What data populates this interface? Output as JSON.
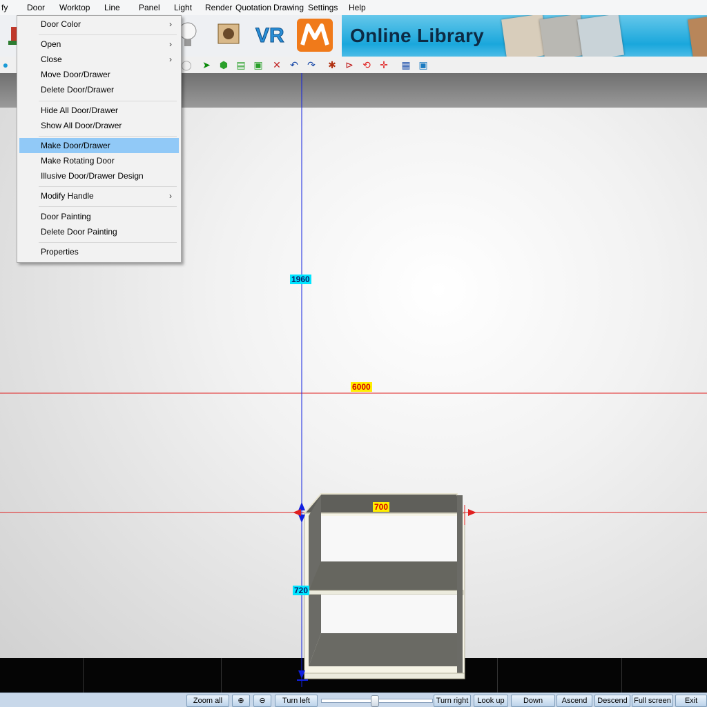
{
  "menubar": [
    "fy",
    "Door",
    "Worktop",
    "Line",
    "Panel",
    "Light",
    "Render",
    "Quotation",
    "Drawing",
    "Settings",
    "Help"
  ],
  "banner": {
    "title": "Online Library",
    "vr_label": "VR"
  },
  "door_menu": {
    "items": [
      {
        "label": "Door Color",
        "submenu": true
      },
      {
        "label": "Open",
        "submenu": true
      },
      {
        "label": "Close",
        "submenu": true
      },
      {
        "label": "Move Door/Drawer",
        "submenu": false
      },
      {
        "label": "Delete Door/Drawer",
        "submenu": false
      },
      {
        "label": "Hide All Door/Drawer",
        "submenu": false
      },
      {
        "label": "Show All Door/Drawer",
        "submenu": false
      },
      {
        "label": "Make Door/Drawer",
        "submenu": false,
        "highlighted": true
      },
      {
        "label": "Make Rotating Door",
        "submenu": false
      },
      {
        "label": "Illusive Door/Drawer Design",
        "submenu": false
      },
      {
        "label": "Modify Handle",
        "submenu": true
      },
      {
        "label": "Door Painting",
        "submenu": false
      },
      {
        "label": "Delete Door Painting",
        "submenu": false
      },
      {
        "label": "Properties",
        "submenu": false
      }
    ],
    "submenu_arrow": "›"
  },
  "dimensions": {
    "height_total": "1960",
    "room_width": "6000",
    "cabinet_width": "700",
    "cabinet_height": "720"
  },
  "statusbar": [
    "Zoom all",
    "Turn left",
    "Turn right",
    "Look up",
    "Down",
    "Ascend",
    "Descend",
    "Full screen",
    "Exit"
  ],
  "colors": {
    "highlight": "#91c9f7",
    "dim_cyan": "#00e5ff",
    "dim_yellow": "#ffee00",
    "blue_line": "#1020e0",
    "red_line": "#e02020"
  }
}
